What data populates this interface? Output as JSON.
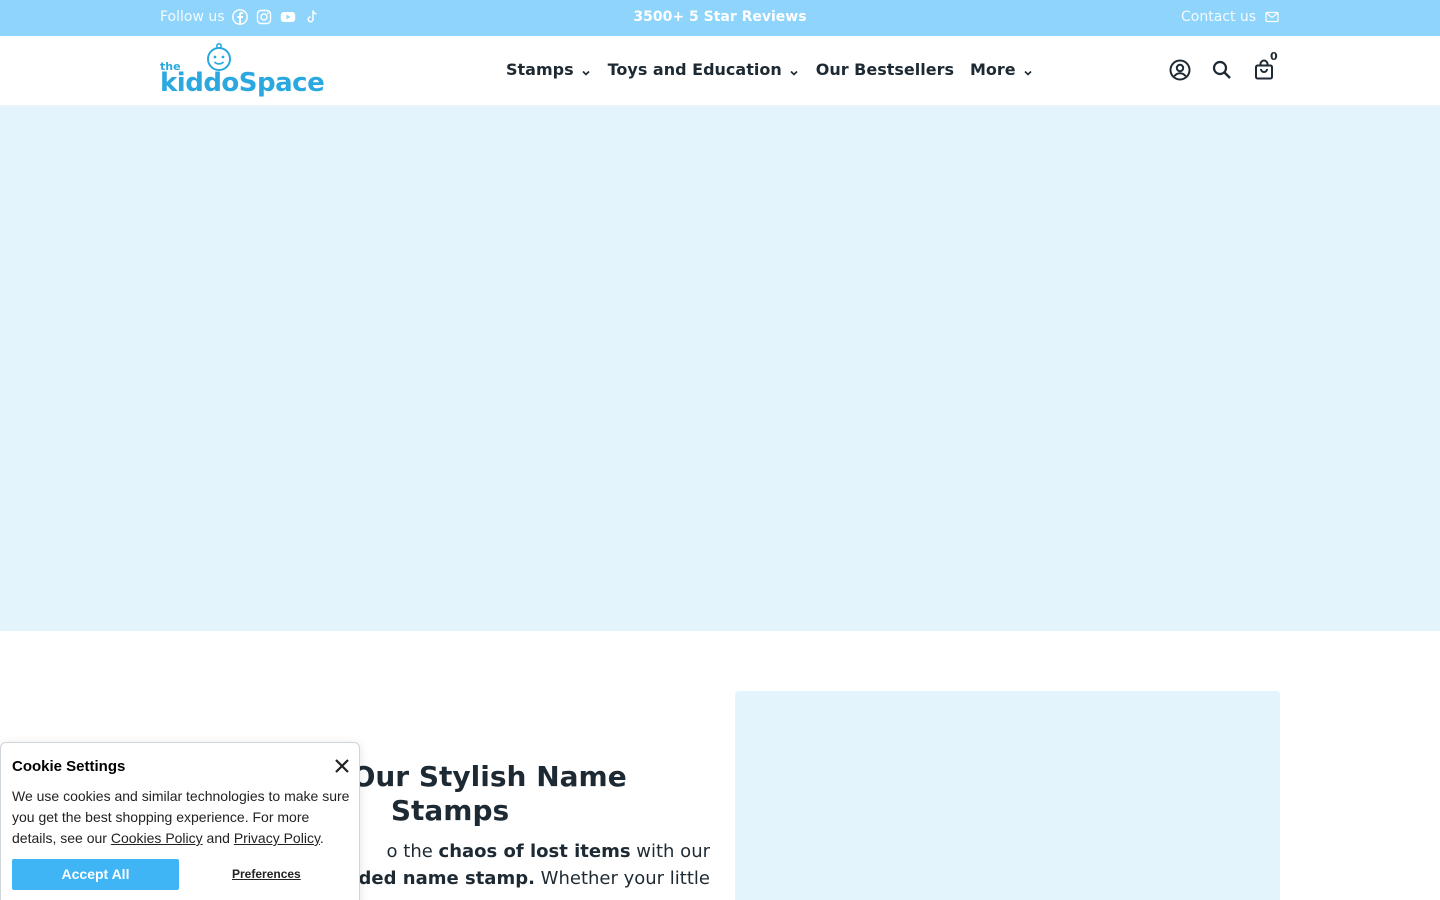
{
  "topbar": {
    "follow_label": "Follow us",
    "socials": [
      "facebook-icon",
      "instagram-icon",
      "youtube-icon",
      "tiktok-icon"
    ],
    "reviews": "3500+ 5 Star Reviews",
    "contact_label": "Contact us"
  },
  "header": {
    "logo_the": "the",
    "logo_word": "kiddoSpace",
    "nav": [
      {
        "label": "Stamps",
        "has_dropdown": true
      },
      {
        "label": "Toys and Education",
        "has_dropdown": true
      },
      {
        "label": "Our Bestsellers",
        "has_dropdown": false
      },
      {
        "label": "More",
        "has_dropdown": true
      }
    ],
    "cart_count": "0"
  },
  "promo": {
    "title": "Now Our Stylish Name Stamps",
    "text_1": "o the ",
    "text_bold_1": "chaos of lost items",
    "text_2": " with our",
    "text_bold_2": "le-sided name stamp.",
    "text_3": " Whether your little"
  },
  "cookie": {
    "title": "Cookie Settings",
    "body_1": "We use cookies and similar technologies to make sure you get the best shopping experience. For more details, see our ",
    "cookies_policy": "Cookies Policy",
    "body_and": " and ",
    "privacy_policy": "Privacy Policy",
    "body_end": ".",
    "accept_label": "Accept All",
    "preferences_label": "Preferences"
  },
  "colors": {
    "topbar_bg": "#8fd4fb",
    "hero_bg": "#e3f4fc",
    "brand": "#2ba8e0",
    "accept_bg": "#40b5f6"
  }
}
